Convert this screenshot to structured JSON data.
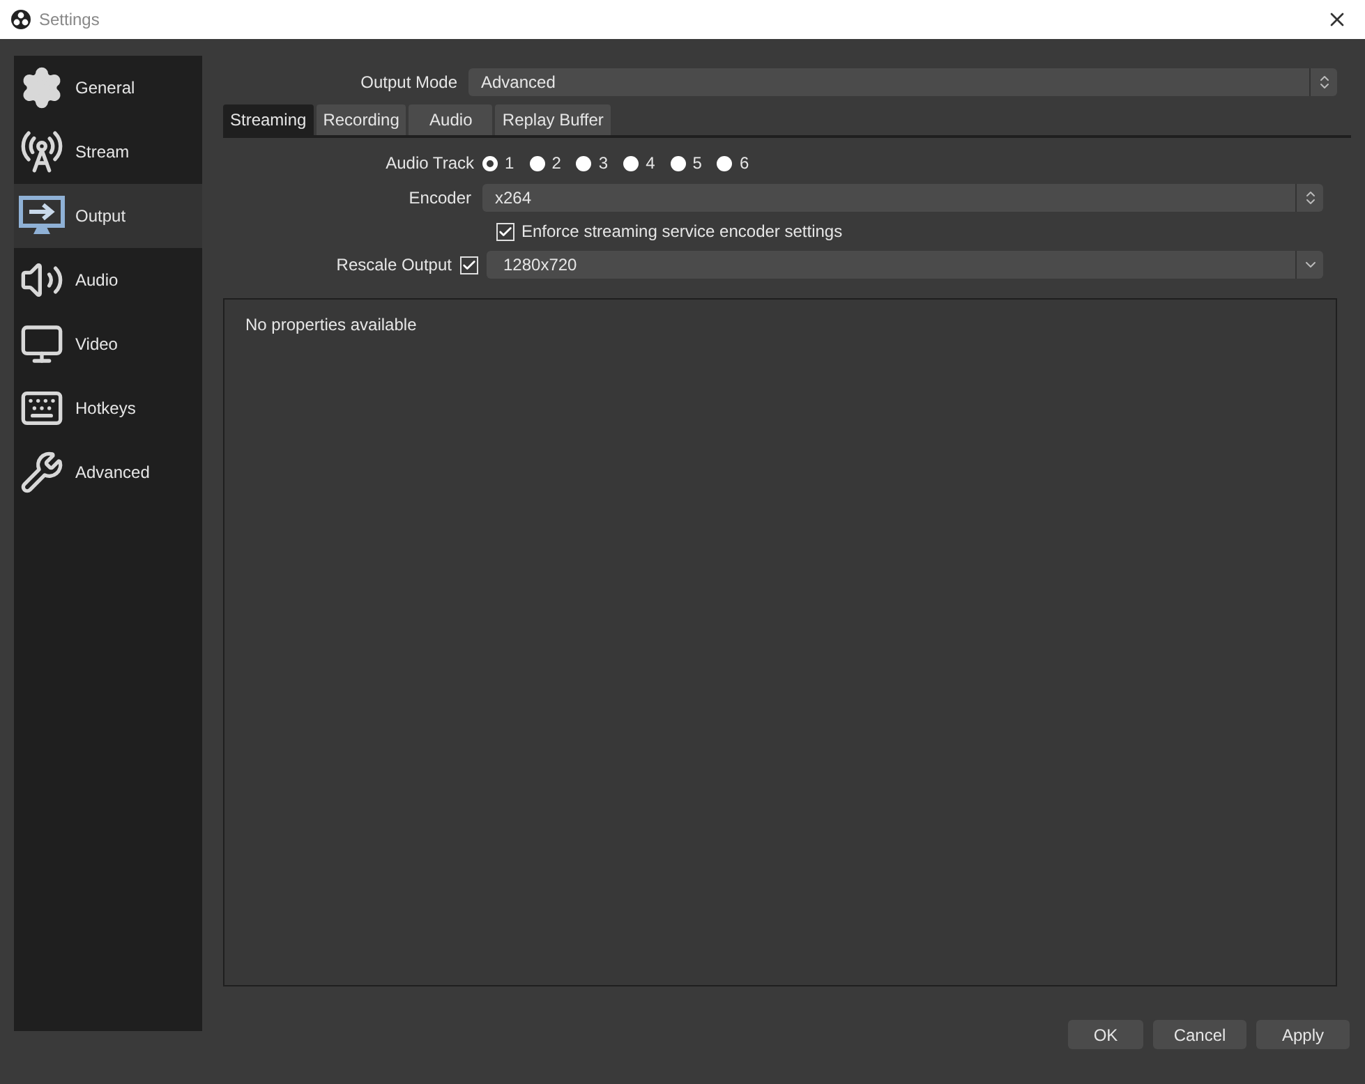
{
  "window": {
    "title": "Settings"
  },
  "sidebar": {
    "items": [
      {
        "label": "General",
        "kind": "general",
        "selected": false
      },
      {
        "label": "Stream",
        "kind": "stream",
        "selected": false
      },
      {
        "label": "Output",
        "kind": "output",
        "selected": true
      },
      {
        "label": "Audio",
        "kind": "audio",
        "selected": false
      },
      {
        "label": "Video",
        "kind": "video",
        "selected": false
      },
      {
        "label": "Hotkeys",
        "kind": "hotkeys",
        "selected": false
      },
      {
        "label": "Advanced",
        "kind": "advanced",
        "selected": false
      }
    ]
  },
  "output_mode": {
    "label": "Output Mode",
    "value": "Advanced"
  },
  "tabs": [
    {
      "label": "Streaming",
      "selected": true
    },
    {
      "label": "Recording",
      "selected": false
    },
    {
      "label": "Audio",
      "selected": false
    },
    {
      "label": "Replay Buffer",
      "selected": false
    }
  ],
  "audio_track": {
    "label": "Audio Track",
    "options": [
      {
        "label": "1",
        "selected": true
      },
      {
        "label": "2",
        "selected": false
      },
      {
        "label": "3",
        "selected": false
      },
      {
        "label": "4",
        "selected": false
      },
      {
        "label": "5",
        "selected": false
      },
      {
        "label": "6",
        "selected": false
      }
    ]
  },
  "encoder": {
    "label": "Encoder",
    "value": "x264"
  },
  "enforce": {
    "label": "Enforce streaming service encoder settings",
    "checked": true
  },
  "rescale": {
    "label": "Rescale Output",
    "checked": true,
    "value": "1280x720"
  },
  "properties": {
    "message": "No properties available"
  },
  "buttons": [
    "OK",
    "Cancel",
    "Apply"
  ]
}
